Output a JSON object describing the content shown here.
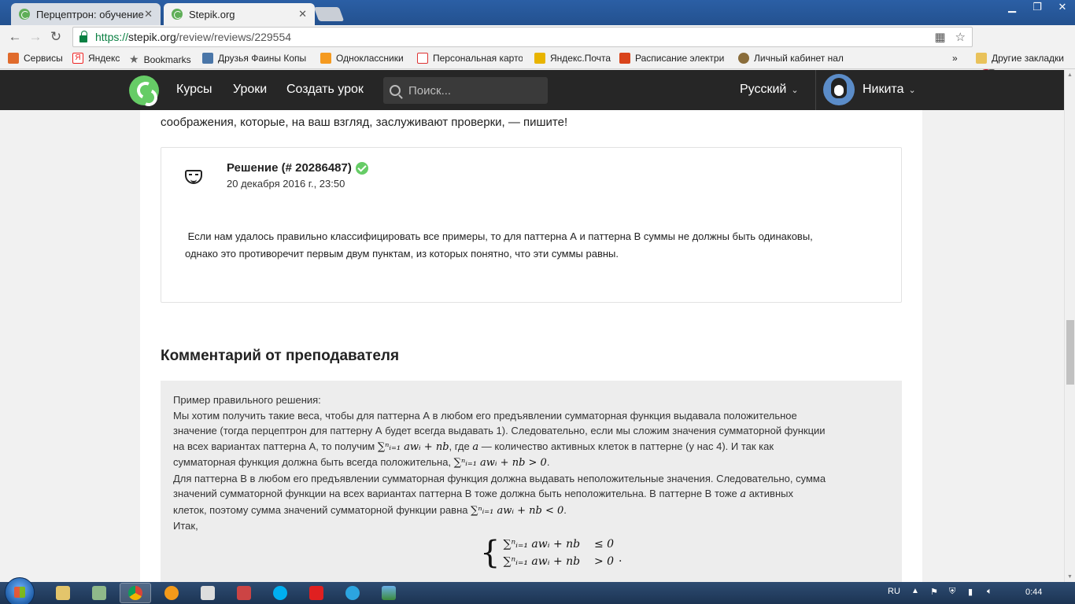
{
  "browser": {
    "tabs": [
      {
        "title": "Перцептрон: обучение"
      },
      {
        "title": "Stepik.org"
      }
    ],
    "url_scheme": "https://",
    "url_host": "stepik.org",
    "url_path": "/review/reviews/229554",
    "bookmarks": [
      {
        "label": "Сервисы",
        "icon": "apps-grid-icon",
        "color": "#e06b2c"
      },
      {
        "label": "Яндекс",
        "icon": "yandex-icon",
        "color": "#e22"
      },
      {
        "label": "Bookmarks",
        "icon": "star-icon",
        "color": "#666"
      },
      {
        "label": "Друзья Фаины Копы",
        "icon": "vk-icon",
        "color": "#4a76a8"
      },
      {
        "label": "Одноклассники",
        "icon": "ok-icon",
        "color": "#f59a20"
      },
      {
        "label": "Персональная карто",
        "icon": "medical-card-icon",
        "color": "#d33"
      },
      {
        "label": "Яндекс.Почта",
        "icon": "mail-icon",
        "color": "#e8b400"
      },
      {
        "label": "Расписание электри",
        "icon": "train-icon",
        "color": "#d9441b"
      },
      {
        "label": "Личный кабинет нал",
        "icon": "tax-icon",
        "color": "#8a6d3b"
      },
      {
        "label": "Другие закладки",
        "icon": "folder-icon",
        "color": "#e9c25b"
      }
    ],
    "more_bookmarks": "»",
    "abp_badge": "1"
  },
  "site": {
    "nav": [
      "Курсы",
      "Уроки",
      "Создать урок"
    ],
    "search_placeholder": "Поиск...",
    "language": "Русский",
    "user_name": "Никита"
  },
  "main": {
    "intro_text": "соображения, которые, на ваш взгляд, заслуживают проверки, — пишите!",
    "solution": {
      "title": "Решение (# 20286487)",
      "date": "20 декабря 2016 г., 23:50",
      "text_line1": " Если нам удалось правильно классифицировать все примеры, то для паттерна А и паттерна В суммы не должны быть одинаковы,",
      "text_line2": "однако это противоречит первым двум пунктам, из которых понятно, что эти суммы равны."
    },
    "comment_heading": "Комментарий от преподавателя",
    "comment": {
      "p0": "Пример правильного решения:",
      "p1a": "Мы хотим получить такие веса, чтобы для паттерна А в любом его предъявлении сумматорная функция выдавала положительное",
      "p1b": "значение (тогда перцептрон для паттерну А будет всегда выдавать 1). Следовательно, если мы сложим значения сумматорной функции",
      "p1c_pre": "на всех вариантах паттерна А, то получим ",
      "formula1": "∑ⁿᵢ₌₁ awᵢ + nb",
      "p1c_mid": ", где ",
      "var_a": "a",
      "p1c_post": " — количество активных клеток в паттерне (у нас 4). И так как",
      "p1d_pre": "сумматорная функция должна быть всегда положительна, ",
      "formula2": "∑ⁿᵢ₌₁ awᵢ + nb > 0",
      "p2a": "Для паттерна В в любом его предъявлении сумматорная функция должна выдавать неположительные значения. Следовательно, сумма",
      "p2b_pre": "значений сумматорной функции на всех вариантах паттерна В тоже должна быть неположительна. В паттерне В тоже ",
      "p2b_post": " активных",
      "p2c_pre": "клеток, поэтому сумма значений сумматорной функции равна ",
      "formula3": "∑ⁿᵢ₌₁ awᵢ + nb < 0",
      "p3": "Итак,",
      "sys_row1": "∑ⁿᵢ₌₁ awᵢ + nb    ≤ 0",
      "sys_row2": "∑ⁿᵢ₌₁ awᵢ + nb    > 0"
    }
  },
  "taskbar": {
    "lang": "RU",
    "clock": "0:44"
  }
}
